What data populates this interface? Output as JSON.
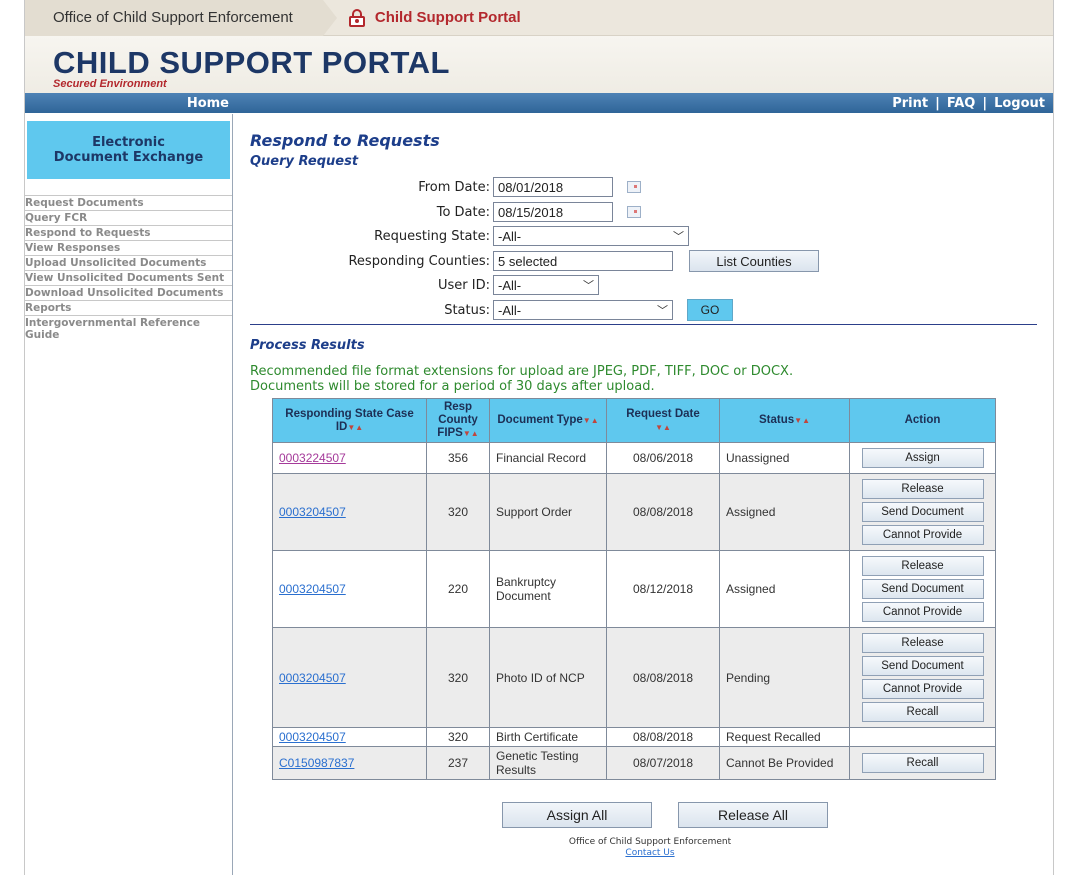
{
  "topbar": {
    "crumb1": "Office of Child Support Enforcement",
    "crumb2": "Child Support Portal"
  },
  "header": {
    "title": "CHILD SUPPORT PORTAL",
    "subtitle": "Secured Environment"
  },
  "nav": {
    "home": "Home",
    "print": "Print",
    "faq": "FAQ",
    "logout": "Logout",
    "sep": "|"
  },
  "sidebar": {
    "heading": "Electronic Document Exchange",
    "items": [
      "Request Documents",
      "Query FCR",
      "Respond to Requests",
      "View Responses",
      "Upload Unsolicited Documents",
      "View Unsolicited Documents Sent",
      "Download Unsolicited Documents",
      "Reports",
      "Intergovernmental Reference Guide"
    ]
  },
  "main": {
    "title": "Respond to Requests",
    "subtitle": "Query Request",
    "form": {
      "from_label": "From Date:",
      "from_value": "08/01/2018",
      "to_label": "To Date:",
      "to_value": "08/15/2018",
      "state_label": "Requesting State:",
      "state_value": "-All-",
      "counties_label": "Responding Counties:",
      "counties_value": "5 selected",
      "list_counties": "List Counties",
      "user_label": "User ID:",
      "user_value": "-All-",
      "status_label": "Status:",
      "status_value": "-All-",
      "go": "GO"
    },
    "process_title": "Process Results",
    "note_line1": "Recommended file format extensions for upload are JPEG, PDF, TIFF, DOC or DOCX.",
    "note_line2": "Documents will be stored for a period of 30 days after upload."
  },
  "table": {
    "headers": {
      "case": "Responding State Case ID",
      "fips": "Resp County FIPS",
      "doctype": "Document Type",
      "date": "Request Date",
      "status": "Status",
      "action": "Action"
    },
    "sort_glyph": "▼▲",
    "rows": [
      {
        "case": "0003224507",
        "fips": "356",
        "doctype": "Financial Record",
        "date": "08/06/2018",
        "status": "Unassigned",
        "actions": [
          "Assign"
        ]
      },
      {
        "case": "0003204507",
        "fips": "320",
        "doctype": "Support Order",
        "date": "08/08/2018",
        "status": "Assigned",
        "actions": [
          "Release",
          "Send Document",
          "Cannot Provide"
        ]
      },
      {
        "case": "0003204507",
        "fips": "220",
        "doctype": "Bankruptcy Document",
        "date": "08/12/2018",
        "status": "Assigned",
        "actions": [
          "Release",
          "Send Document",
          "Cannot Provide"
        ]
      },
      {
        "case": "0003204507",
        "fips": "320",
        "doctype": "Photo ID of NCP",
        "date": "08/08/2018",
        "status": "Pending",
        "actions": [
          "Release",
          "Send Document",
          "Cannot Provide",
          "Recall"
        ]
      },
      {
        "case": "0003204507",
        "fips": "320",
        "doctype": "Birth Certificate",
        "date": "08/08/2018",
        "status": "Request Recalled",
        "actions": []
      },
      {
        "case": "C0150987837",
        "fips": "237",
        "doctype": "Genetic Testing Results",
        "date": "08/07/2018",
        "status": "Cannot Be Provided",
        "actions": [
          "Recall"
        ]
      }
    ]
  },
  "bottom": {
    "assign_all": "Assign All",
    "release_all": "Release All"
  },
  "footer": {
    "org": "Office of Child Support Enforcement",
    "contact": "Contact Us"
  }
}
